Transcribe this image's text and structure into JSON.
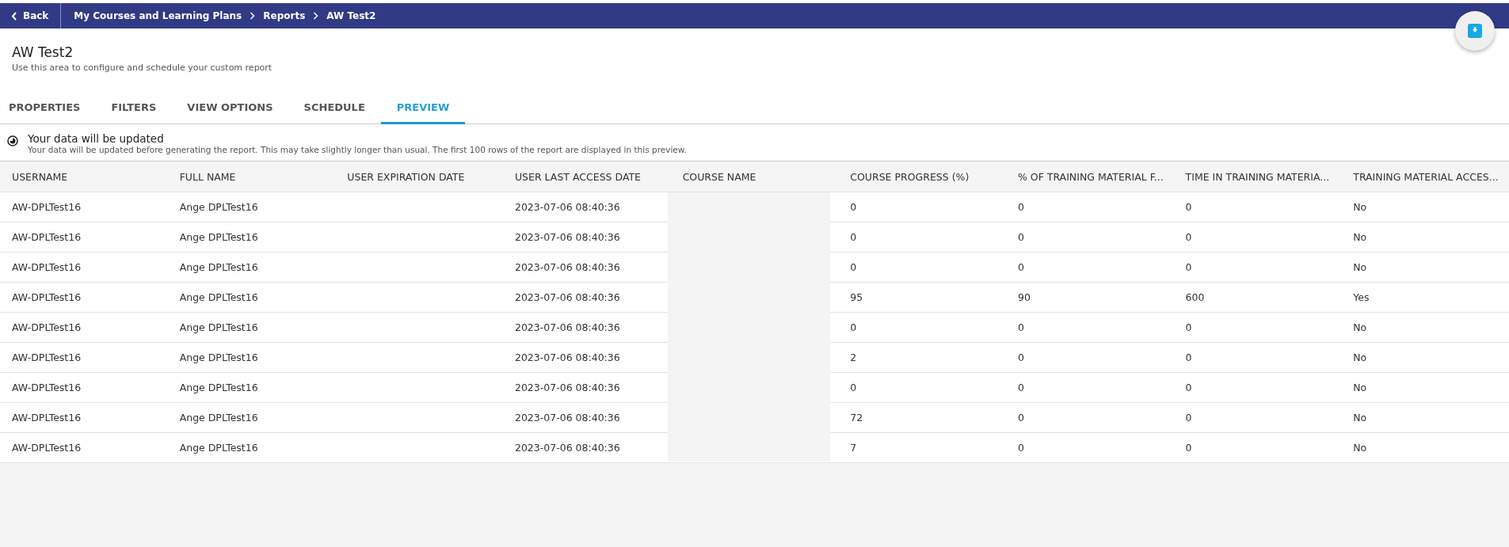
{
  "nav": {
    "back": "Back",
    "breadcrumbs": [
      "My Courses and Learning Plans",
      "Reports",
      "AW Test2"
    ]
  },
  "header": {
    "title": "AW Test2",
    "subtitle": "Use this area to configure and schedule your custom report"
  },
  "tabs": [
    {
      "label": "PROPERTIES",
      "selected": false
    },
    {
      "label": "FILTERS",
      "selected": false
    },
    {
      "label": "VIEW OPTIONS",
      "selected": false
    },
    {
      "label": "SCHEDULE",
      "selected": false
    },
    {
      "label": "PREVIEW",
      "selected": true
    }
  ],
  "notice": {
    "title": "Your data will be updated",
    "text": "Your data will be updated before generating the report. This may take slightly longer than usual. The first 100 rows of the report are displayed in this preview."
  },
  "table": {
    "columns": [
      "USERNAME",
      "FULL NAME",
      "USER EXPIRATION DATE",
      "USER LAST ACCESS DATE",
      "COURSE NAME",
      "COURSE PROGRESS (%)",
      "% OF TRAINING MATERIAL F...",
      "TIME IN TRAINING MATERIA...",
      "TRAINING MATERIAL ACCES..."
    ],
    "rows": [
      [
        "AW-DPLTest16",
        "Ange DPLTest16",
        "",
        "2023-07-06 08:40:36",
        "",
        "0",
        "0",
        "0",
        "No"
      ],
      [
        "AW-DPLTest16",
        "Ange DPLTest16",
        "",
        "2023-07-06 08:40:36",
        "",
        "0",
        "0",
        "0",
        "No"
      ],
      [
        "AW-DPLTest16",
        "Ange DPLTest16",
        "",
        "2023-07-06 08:40:36",
        "",
        "0",
        "0",
        "0",
        "No"
      ],
      [
        "AW-DPLTest16",
        "Ange DPLTest16",
        "",
        "2023-07-06 08:40:36",
        "",
        "95",
        "90",
        "600",
        "Yes"
      ],
      [
        "AW-DPLTest16",
        "Ange DPLTest16",
        "",
        "2023-07-06 08:40:36",
        "",
        "0",
        "0",
        "0",
        "No"
      ],
      [
        "AW-DPLTest16",
        "Ange DPLTest16",
        "",
        "2023-07-06 08:40:36",
        "",
        "2",
        "0",
        "0",
        "No"
      ],
      [
        "AW-DPLTest16",
        "Ange DPLTest16",
        "",
        "2023-07-06 08:40:36",
        "",
        "0",
        "0",
        "0",
        "No"
      ],
      [
        "AW-DPLTest16",
        "Ange DPLTest16",
        "",
        "2023-07-06 08:40:36",
        "",
        "72",
        "0",
        "0",
        "No"
      ],
      [
        "AW-DPLTest16",
        "Ange DPLTest16",
        "",
        "2023-07-06 08:40:36",
        "",
        "7",
        "0",
        "0",
        "No"
      ]
    ]
  }
}
